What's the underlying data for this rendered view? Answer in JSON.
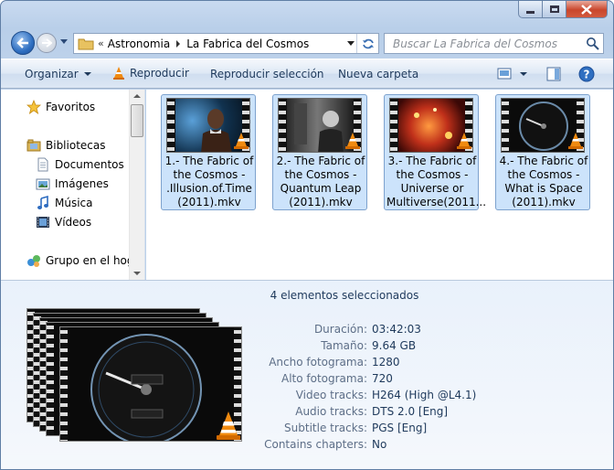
{
  "window": {
    "title": "",
    "colors": {
      "accent": "#1e395b",
      "selection": "#cce3fb",
      "close": "#c9462c"
    }
  },
  "address_bar": {
    "overflow": "«",
    "crumbs": [
      "Astronomia",
      "La Fabrica del Cosmos"
    ]
  },
  "search": {
    "placeholder": "Buscar La Fabrica del Cosmos"
  },
  "toolbar": {
    "organize_label": "Organizar",
    "play_label": "Reproducir",
    "play_selection_label": "Reproducir selección",
    "new_folder_label": "Nueva carpeta"
  },
  "nav": {
    "favorites": "Favoritos",
    "libraries": "Bibliotecas",
    "documents": "Documentos",
    "images": "Imágenes",
    "music": "Música",
    "videos": "Vídeos",
    "homegroup": "Grupo en el hoga"
  },
  "files": [
    {
      "line1": "1.- The Fabric of",
      "line2": "the Cosmos -",
      "line3": ".Illusion.of.Time",
      "line4": "(2011).mkv",
      "icon": "vlc-icon"
    },
    {
      "line1": "2.- The Fabric of",
      "line2": "the Cosmos -",
      "line3": "Quantum Leap",
      "line4": "(2011).mkv",
      "icon": "vlc-icon"
    },
    {
      "line1": "3.- The Fabric of",
      "line2": "the Cosmos -",
      "line3": "Universe or",
      "line4": "Multiverse(2011...",
      "icon": "vlc-icon"
    },
    {
      "line1": "4.- The Fabric of",
      "line2": "the Cosmos -",
      "line3": "What is Space",
      "line4": "(2011).mkv",
      "icon": "vlc-icon"
    }
  ],
  "details": {
    "title": "4 elementos seleccionados",
    "properties": [
      {
        "label": "Duración:",
        "value": "03:42:03"
      },
      {
        "label": "Tamaño:",
        "value": "9.64 GB"
      },
      {
        "label": "Ancho fotograma:",
        "value": "1280"
      },
      {
        "label": "Alto fotograma:",
        "value": "720"
      },
      {
        "label": "Video tracks:",
        "value": "H264 (High @L4.1)"
      },
      {
        "label": "Audio tracks:",
        "value": "DTS 2.0 [Eng]"
      },
      {
        "label": "Subtitle tracks:",
        "value": "PGS [Eng]"
      },
      {
        "label": "Contains chapters:",
        "value": "No"
      }
    ]
  }
}
